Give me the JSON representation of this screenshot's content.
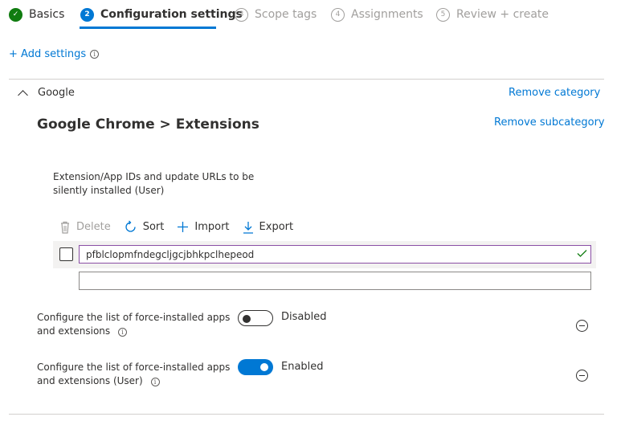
{
  "wizard": {
    "steps": [
      {
        "num": "✓",
        "label": "Basics",
        "state": "done"
      },
      {
        "num": "2",
        "label": "Configuration settings",
        "state": "active"
      },
      {
        "num": "3",
        "label": "Scope tags",
        "state": "disabled"
      },
      {
        "num": "4",
        "label": "Assignments",
        "state": "disabled"
      },
      {
        "num": "5",
        "label": "Review + create",
        "state": "disabled"
      }
    ]
  },
  "add_settings": {
    "label": "+ Add settings",
    "info": "i"
  },
  "category": {
    "name": "Google",
    "remove_category": "Remove category",
    "subcategory": "Google Chrome > Extensions",
    "remove_subcategory": "Remove subcategory"
  },
  "extension_field": {
    "label": "Extension/App IDs and update URLs to be silently installed (User)",
    "toolbar": {
      "delete": "Delete",
      "sort": "Sort",
      "import": "Import",
      "export": "Export"
    },
    "entries": [
      {
        "value": "pfblclopmfndegcljgcjbhkpclhepeod",
        "valid": true
      }
    ],
    "new_entry_value": ""
  },
  "settings": [
    {
      "label": "Configure the list of force-installed apps and extensions",
      "state_label": "Disabled",
      "enabled": false,
      "info": "i"
    },
    {
      "label": "Configure the list of force-installed apps and extensions (User)",
      "state_label": "Enabled",
      "enabled": true,
      "info": "i"
    }
  ],
  "colors": {
    "accent": "#0078d4",
    "success": "#107c10",
    "valid_border": "#8a4fa5"
  }
}
